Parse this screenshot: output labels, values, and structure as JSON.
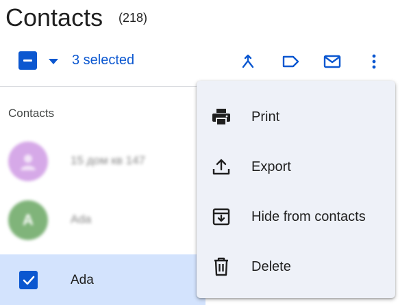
{
  "header": {
    "title": "Contacts",
    "count": "(218)"
  },
  "selection": {
    "label": "3 selected",
    "select_all_icon": "indeterminate-checkbox-icon",
    "dropdown_icon": "caret-down-icon"
  },
  "toolbar": {
    "icons": [
      "merge-icon",
      "label-icon",
      "email-icon",
      "more-vert-icon"
    ]
  },
  "list": {
    "section_label": "Contacts",
    "rows": [
      {
        "name": "15 дом кв 147",
        "avatar_color": "#d6a9e8",
        "selected": false
      },
      {
        "name": "Ada",
        "avatar_letter": "A",
        "avatar_color": "#80b47a",
        "selected": false
      },
      {
        "name": "Ada",
        "selected": true
      }
    ]
  },
  "menu": {
    "items": [
      {
        "label": "Print",
        "icon": "print-icon"
      },
      {
        "label": "Export",
        "icon": "export-icon"
      },
      {
        "label": "Hide from contacts",
        "icon": "archive-icon"
      },
      {
        "label": "Delete",
        "icon": "trash-icon"
      }
    ]
  },
  "colors": {
    "accent": "#0b57d0",
    "selected_row": "#d3e3fd",
    "menu_bg": "#eef1f8"
  }
}
